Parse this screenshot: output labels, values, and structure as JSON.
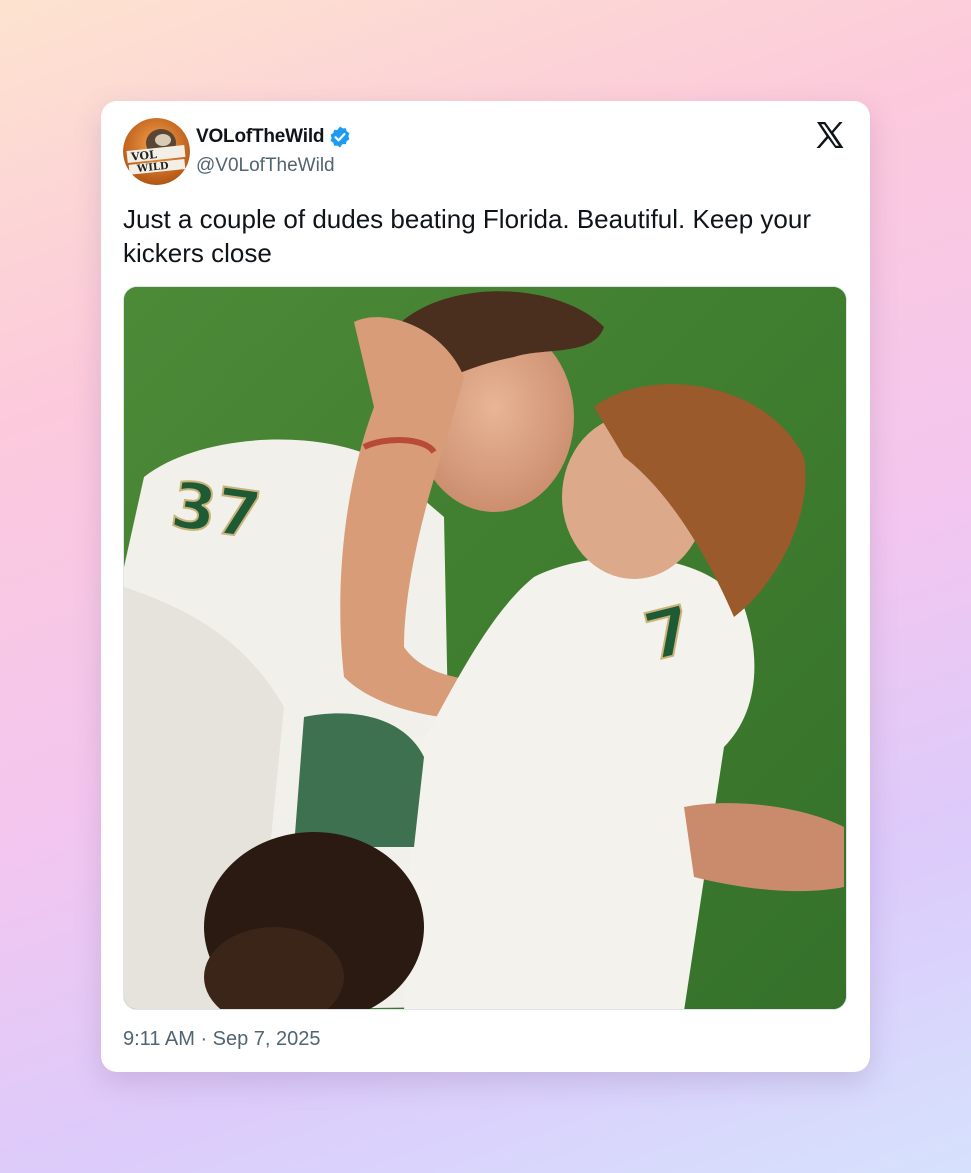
{
  "tweet": {
    "display_name": "VOLofTheWild",
    "handle": "@V0LofTheWild",
    "verified": true,
    "text": "Just a couple of dudes beating Florida. Beautiful. Keep your kickers close",
    "timestamp": "9:11 AM · Sep 7, 2025",
    "avatar_text": "VOL WILD",
    "media": {
      "description_icon": "football-celebration-photo",
      "jersey_numbers": [
        "37",
        "7"
      ]
    }
  },
  "icons": {
    "verified": "verified-badge-icon",
    "platform": "x-logo-icon"
  },
  "colors": {
    "verified_blue": "#1d9bf0",
    "text_primary": "#0f1419",
    "text_secondary": "#536471",
    "jersey_green": "#1e5b34"
  }
}
